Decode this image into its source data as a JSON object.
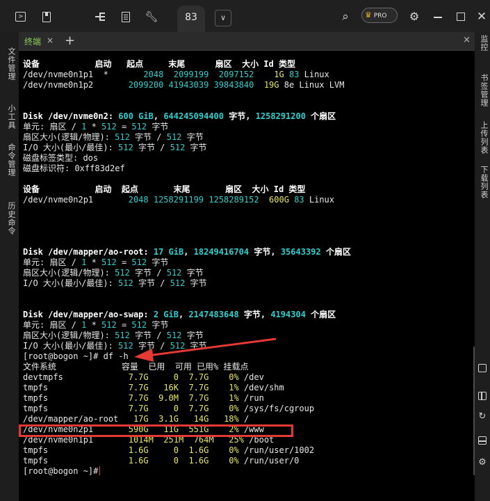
{
  "toolbar": {
    "active_tab_label": "83",
    "pro_label": "PRO",
    "icons": [
      "terminal-icon",
      "bookmark-icon",
      "split-icon",
      "document-icon",
      "wrench-icon",
      "search-icon",
      "settings-icon",
      "minimize-icon",
      "maximize-icon",
      "close-icon"
    ]
  },
  "tabs": {
    "terminal_label": "终端",
    "add": "+",
    "close": "×",
    "close_panel": "×"
  },
  "left_sidebar": {
    "items": [
      "文件管理",
      "小工具",
      "命令管理",
      "历史命令"
    ]
  },
  "right_sidebar": {
    "items": [
      "监控",
      "书签管理",
      "上传列表",
      "下载列表"
    ]
  },
  "terminal": {
    "lines": [
      {
        "segs": [
          {
            "t": "设备           启动   起点     末尾      扇区  大小 Id 类型",
            "s": "b"
          }
        ]
      },
      {
        "segs": [
          {
            "t": "/dev/nvme0n1p1  *       ",
            "s": ""
          },
          {
            "t": "2048",
            "s": "c"
          },
          {
            "t": "  ",
            "s": ""
          },
          {
            "t": "2099199",
            "s": "c"
          },
          {
            "t": "  ",
            "s": ""
          },
          {
            "t": "2097152",
            "s": "c"
          },
          {
            "t": "    ",
            "s": ""
          },
          {
            "t": "1G",
            "s": "y"
          },
          {
            "t": " ",
            "s": ""
          },
          {
            "t": "83",
            "s": "c"
          },
          {
            "t": " Linux",
            "s": ""
          }
        ]
      },
      {
        "segs": [
          {
            "t": "/dev/nvme0n1p2       ",
            "s": ""
          },
          {
            "t": "2099200",
            "s": "c"
          },
          {
            "t": " ",
            "s": ""
          },
          {
            "t": "41943039",
            "s": "c"
          },
          {
            "t": " ",
            "s": ""
          },
          {
            "t": "39843840",
            "s": "c"
          },
          {
            "t": "  ",
            "s": ""
          },
          {
            "t": "19G",
            "s": "y"
          },
          {
            "t": " 8e Linux LVM",
            "s": ""
          }
        ]
      },
      {
        "segs": [
          {
            "t": "",
            "s": ""
          }
        ]
      },
      {
        "segs": [
          {
            "t": "",
            "s": ""
          }
        ]
      },
      {
        "segs": [
          {
            "t": "Disk /dev/nvme0n2: ",
            "s": "b"
          },
          {
            "t": "600 GiB",
            "s": "cb"
          },
          {
            "t": ", ",
            "s": "b"
          },
          {
            "t": "644245094400",
            "s": "cb"
          },
          {
            "t": " 字节, ",
            "s": "b"
          },
          {
            "t": "1258291200",
            "s": "cb"
          },
          {
            "t": " 个扇区",
            "s": "b"
          }
        ]
      },
      {
        "segs": [
          {
            "t": "单元: 扇区 / ",
            "s": ""
          },
          {
            "t": "1",
            "s": "c"
          },
          {
            "t": " * ",
            "s": ""
          },
          {
            "t": "512",
            "s": "c"
          },
          {
            "t": " = ",
            "s": ""
          },
          {
            "t": "512",
            "s": "c"
          },
          {
            "t": " 字节",
            "s": ""
          }
        ]
      },
      {
        "segs": [
          {
            "t": "扇区大小(逻辑/物理): ",
            "s": ""
          },
          {
            "t": "512",
            "s": "c"
          },
          {
            "t": " 字节 / ",
            "s": ""
          },
          {
            "t": "512",
            "s": "c"
          },
          {
            "t": " 字节",
            "s": ""
          }
        ]
      },
      {
        "segs": [
          {
            "t": "I/O 大小(最小/最佳): ",
            "s": ""
          },
          {
            "t": "512",
            "s": "c"
          },
          {
            "t": " 字节 / ",
            "s": ""
          },
          {
            "t": "512",
            "s": "c"
          },
          {
            "t": " 字节",
            "s": ""
          }
        ]
      },
      {
        "segs": [
          {
            "t": "磁盘标签类型: dos",
            "s": ""
          }
        ]
      },
      {
        "segs": [
          {
            "t": "磁盘标识符: 0xff83d2ef",
            "s": ""
          }
        ]
      },
      {
        "segs": [
          {
            "t": "",
            "s": ""
          }
        ]
      },
      {
        "segs": [
          {
            "t": "设备           启动  起点       末尾       扇区  大小 Id 类型",
            "s": "b"
          }
        ]
      },
      {
        "segs": [
          {
            "t": "/dev/nvme0n2p1       ",
            "s": ""
          },
          {
            "t": "2048",
            "s": "c"
          },
          {
            "t": " ",
            "s": ""
          },
          {
            "t": "1258291199",
            "s": "c"
          },
          {
            "t": " ",
            "s": ""
          },
          {
            "t": "1258289152",
            "s": "c"
          },
          {
            "t": "  ",
            "s": ""
          },
          {
            "t": "600G",
            "s": "y"
          },
          {
            "t": " ",
            "s": ""
          },
          {
            "t": "83",
            "s": "c"
          },
          {
            "t": " Linux",
            "s": ""
          }
        ]
      },
      {
        "segs": [
          {
            "t": "",
            "s": ""
          }
        ]
      },
      {
        "segs": [
          {
            "t": "",
            "s": ""
          }
        ]
      },
      {
        "segs": [
          {
            "t": "",
            "s": ""
          }
        ]
      },
      {
        "segs": [
          {
            "t": "",
            "s": ""
          }
        ]
      },
      {
        "segs": [
          {
            "t": "Disk /dev/mapper/ao-root: ",
            "s": "b"
          },
          {
            "t": "17 GiB",
            "s": "cb"
          },
          {
            "t": ", ",
            "s": "b"
          },
          {
            "t": "18249416704",
            "s": "cb"
          },
          {
            "t": " 字节, ",
            "s": "b"
          },
          {
            "t": "35643392",
            "s": "cb"
          },
          {
            "t": " 个扇区",
            "s": "b"
          }
        ]
      },
      {
        "segs": [
          {
            "t": "单元: 扇区 / ",
            "s": ""
          },
          {
            "t": "1",
            "s": "c"
          },
          {
            "t": " * ",
            "s": ""
          },
          {
            "t": "512",
            "s": "c"
          },
          {
            "t": " = ",
            "s": ""
          },
          {
            "t": "512",
            "s": "c"
          },
          {
            "t": " 字节",
            "s": ""
          }
        ]
      },
      {
        "segs": [
          {
            "t": "扇区大小(逻辑/物理): ",
            "s": ""
          },
          {
            "t": "512",
            "s": "c"
          },
          {
            "t": " 字节 / ",
            "s": ""
          },
          {
            "t": "512",
            "s": "c"
          },
          {
            "t": " 字节",
            "s": ""
          }
        ]
      },
      {
        "segs": [
          {
            "t": "I/O 大小(最小/最佳): ",
            "s": ""
          },
          {
            "t": "512",
            "s": "c"
          },
          {
            "t": " 字节 / ",
            "s": ""
          },
          {
            "t": "512",
            "s": "c"
          },
          {
            "t": " 字节",
            "s": ""
          }
        ]
      },
      {
        "segs": [
          {
            "t": "",
            "s": ""
          }
        ]
      },
      {
        "segs": [
          {
            "t": "",
            "s": ""
          }
        ]
      },
      {
        "segs": [
          {
            "t": "Disk /dev/mapper/ao-swap: ",
            "s": "b"
          },
          {
            "t": "2 GiB",
            "s": "cb"
          },
          {
            "t": ", ",
            "s": "b"
          },
          {
            "t": "2147483648",
            "s": "cb"
          },
          {
            "t": " 字节, ",
            "s": "b"
          },
          {
            "t": "4194304",
            "s": "cb"
          },
          {
            "t": " 个扇区",
            "s": "b"
          }
        ]
      },
      {
        "segs": [
          {
            "t": "单元: 扇区 / ",
            "s": ""
          },
          {
            "t": "1",
            "s": "c"
          },
          {
            "t": " * ",
            "s": ""
          },
          {
            "t": "512",
            "s": "c"
          },
          {
            "t": " = ",
            "s": ""
          },
          {
            "t": "512",
            "s": "c"
          },
          {
            "t": " 字节",
            "s": ""
          }
        ]
      },
      {
        "segs": [
          {
            "t": "扇区大小(逻辑/物理): ",
            "s": ""
          },
          {
            "t": "512",
            "s": "c"
          },
          {
            "t": " 字节 / ",
            "s": ""
          },
          {
            "t": "512",
            "s": "c"
          },
          {
            "t": " 字节",
            "s": ""
          }
        ]
      },
      {
        "segs": [
          {
            "t": "I/O 大小(最小/最佳): ",
            "s": ""
          },
          {
            "t": "512",
            "s": "c"
          },
          {
            "t": " 字节 / ",
            "s": ""
          },
          {
            "t": "512",
            "s": "c"
          },
          {
            "t": " 字节",
            "s": ""
          }
        ]
      },
      {
        "segs": [
          {
            "t": "[root@bogon ~]# df -h",
            "s": ""
          }
        ]
      },
      {
        "segs": [
          {
            "t": "文件系统             容量  已用  可用 已用% 挂载点",
            "s": ""
          }
        ]
      },
      {
        "segs": [
          {
            "t": "devtmpfs             ",
            "s": ""
          },
          {
            "t": "7.7G",
            "s": "y"
          },
          {
            "t": "     ",
            "s": ""
          },
          {
            "t": "0",
            "s": "y"
          },
          {
            "t": "  ",
            "s": ""
          },
          {
            "t": "7.7G",
            "s": "y"
          },
          {
            "t": "    ",
            "s": ""
          },
          {
            "t": "0%",
            "s": "y"
          },
          {
            "t": " /dev",
            "s": ""
          }
        ]
      },
      {
        "segs": [
          {
            "t": "tmpfs                ",
            "s": ""
          },
          {
            "t": "7.7G",
            "s": "y"
          },
          {
            "t": "   ",
            "s": ""
          },
          {
            "t": "16K",
            "s": "y"
          },
          {
            "t": "  ",
            "s": ""
          },
          {
            "t": "7.7G",
            "s": "y"
          },
          {
            "t": "    ",
            "s": ""
          },
          {
            "t": "1%",
            "s": "y"
          },
          {
            "t": " /dev/shm",
            "s": ""
          }
        ]
      },
      {
        "segs": [
          {
            "t": "tmpfs                ",
            "s": ""
          },
          {
            "t": "7.7G",
            "s": "y"
          },
          {
            "t": "  ",
            "s": ""
          },
          {
            "t": "9.0M",
            "s": "y"
          },
          {
            "t": "  ",
            "s": ""
          },
          {
            "t": "7.7G",
            "s": "y"
          },
          {
            "t": "    ",
            "s": ""
          },
          {
            "t": "1%",
            "s": "y"
          },
          {
            "t": " /run",
            "s": ""
          }
        ]
      },
      {
        "segs": [
          {
            "t": "tmpfs                ",
            "s": ""
          },
          {
            "t": "7.7G",
            "s": "y"
          },
          {
            "t": "     ",
            "s": ""
          },
          {
            "t": "0",
            "s": "y"
          },
          {
            "t": "  ",
            "s": ""
          },
          {
            "t": "7.7G",
            "s": "y"
          },
          {
            "t": "    ",
            "s": ""
          },
          {
            "t": "0%",
            "s": "y"
          },
          {
            "t": " /sys/fs/cgroup",
            "s": ""
          }
        ]
      },
      {
        "segs": [
          {
            "t": "/dev/mapper/ao-root   ",
            "s": ""
          },
          {
            "t": "17G",
            "s": "y"
          },
          {
            "t": "  ",
            "s": ""
          },
          {
            "t": "3.1G",
            "s": "y"
          },
          {
            "t": "   ",
            "s": ""
          },
          {
            "t": "14G",
            "s": "y"
          },
          {
            "t": "   ",
            "s": ""
          },
          {
            "t": "18%",
            "s": "y"
          },
          {
            "t": " /",
            "s": ""
          }
        ]
      },
      {
        "segs": [
          {
            "t": "/dev/nvme0n2p1       ",
            "s": ""
          },
          {
            "t": "590G",
            "s": "y"
          },
          {
            "t": "   ",
            "s": ""
          },
          {
            "t": "11G",
            "s": "y"
          },
          {
            "t": "  ",
            "s": ""
          },
          {
            "t": "551G",
            "s": "y"
          },
          {
            "t": "    ",
            "s": ""
          },
          {
            "t": "2%",
            "s": "y"
          },
          {
            "t": " /www",
            "s": ""
          }
        ]
      },
      {
        "segs": [
          {
            "t": "/dev/nvme0n1p1       ",
            "s": ""
          },
          {
            "t": "1014M",
            "s": "y"
          },
          {
            "t": "  ",
            "s": ""
          },
          {
            "t": "251M",
            "s": "y"
          },
          {
            "t": "  ",
            "s": ""
          },
          {
            "t": "764M",
            "s": "y"
          },
          {
            "t": "   ",
            "s": ""
          },
          {
            "t": "25%",
            "s": "y"
          },
          {
            "t": " /boot",
            "s": ""
          }
        ]
      },
      {
        "segs": [
          {
            "t": "tmpfs                ",
            "s": ""
          },
          {
            "t": "1.6G",
            "s": "y"
          },
          {
            "t": "     ",
            "s": ""
          },
          {
            "t": "0",
            "s": "y"
          },
          {
            "t": "  ",
            "s": ""
          },
          {
            "t": "1.6G",
            "s": "y"
          },
          {
            "t": "    ",
            "s": ""
          },
          {
            "t": "0%",
            "s": "y"
          },
          {
            "t": " /run/user/1002",
            "s": ""
          }
        ]
      },
      {
        "segs": [
          {
            "t": "tmpfs                ",
            "s": ""
          },
          {
            "t": "1.6G",
            "s": "y"
          },
          {
            "t": "     ",
            "s": ""
          },
          {
            "t": "0",
            "s": "y"
          },
          {
            "t": "  ",
            "s": ""
          },
          {
            "t": "1.6G",
            "s": "y"
          },
          {
            "t": "    ",
            "s": ""
          },
          {
            "t": "0%",
            "s": "y"
          },
          {
            "t": " /run/user/0",
            "s": ""
          }
        ]
      },
      {
        "segs": [
          {
            "t": "[root@bogon ~]#",
            "s": ""
          }
        ]
      }
    ]
  },
  "colors": {
    "cyan": "#2ecfcf",
    "yellow": "#e8e85a",
    "annotation_red": "#e53935",
    "tab_active_green": "#8fcf5a"
  }
}
